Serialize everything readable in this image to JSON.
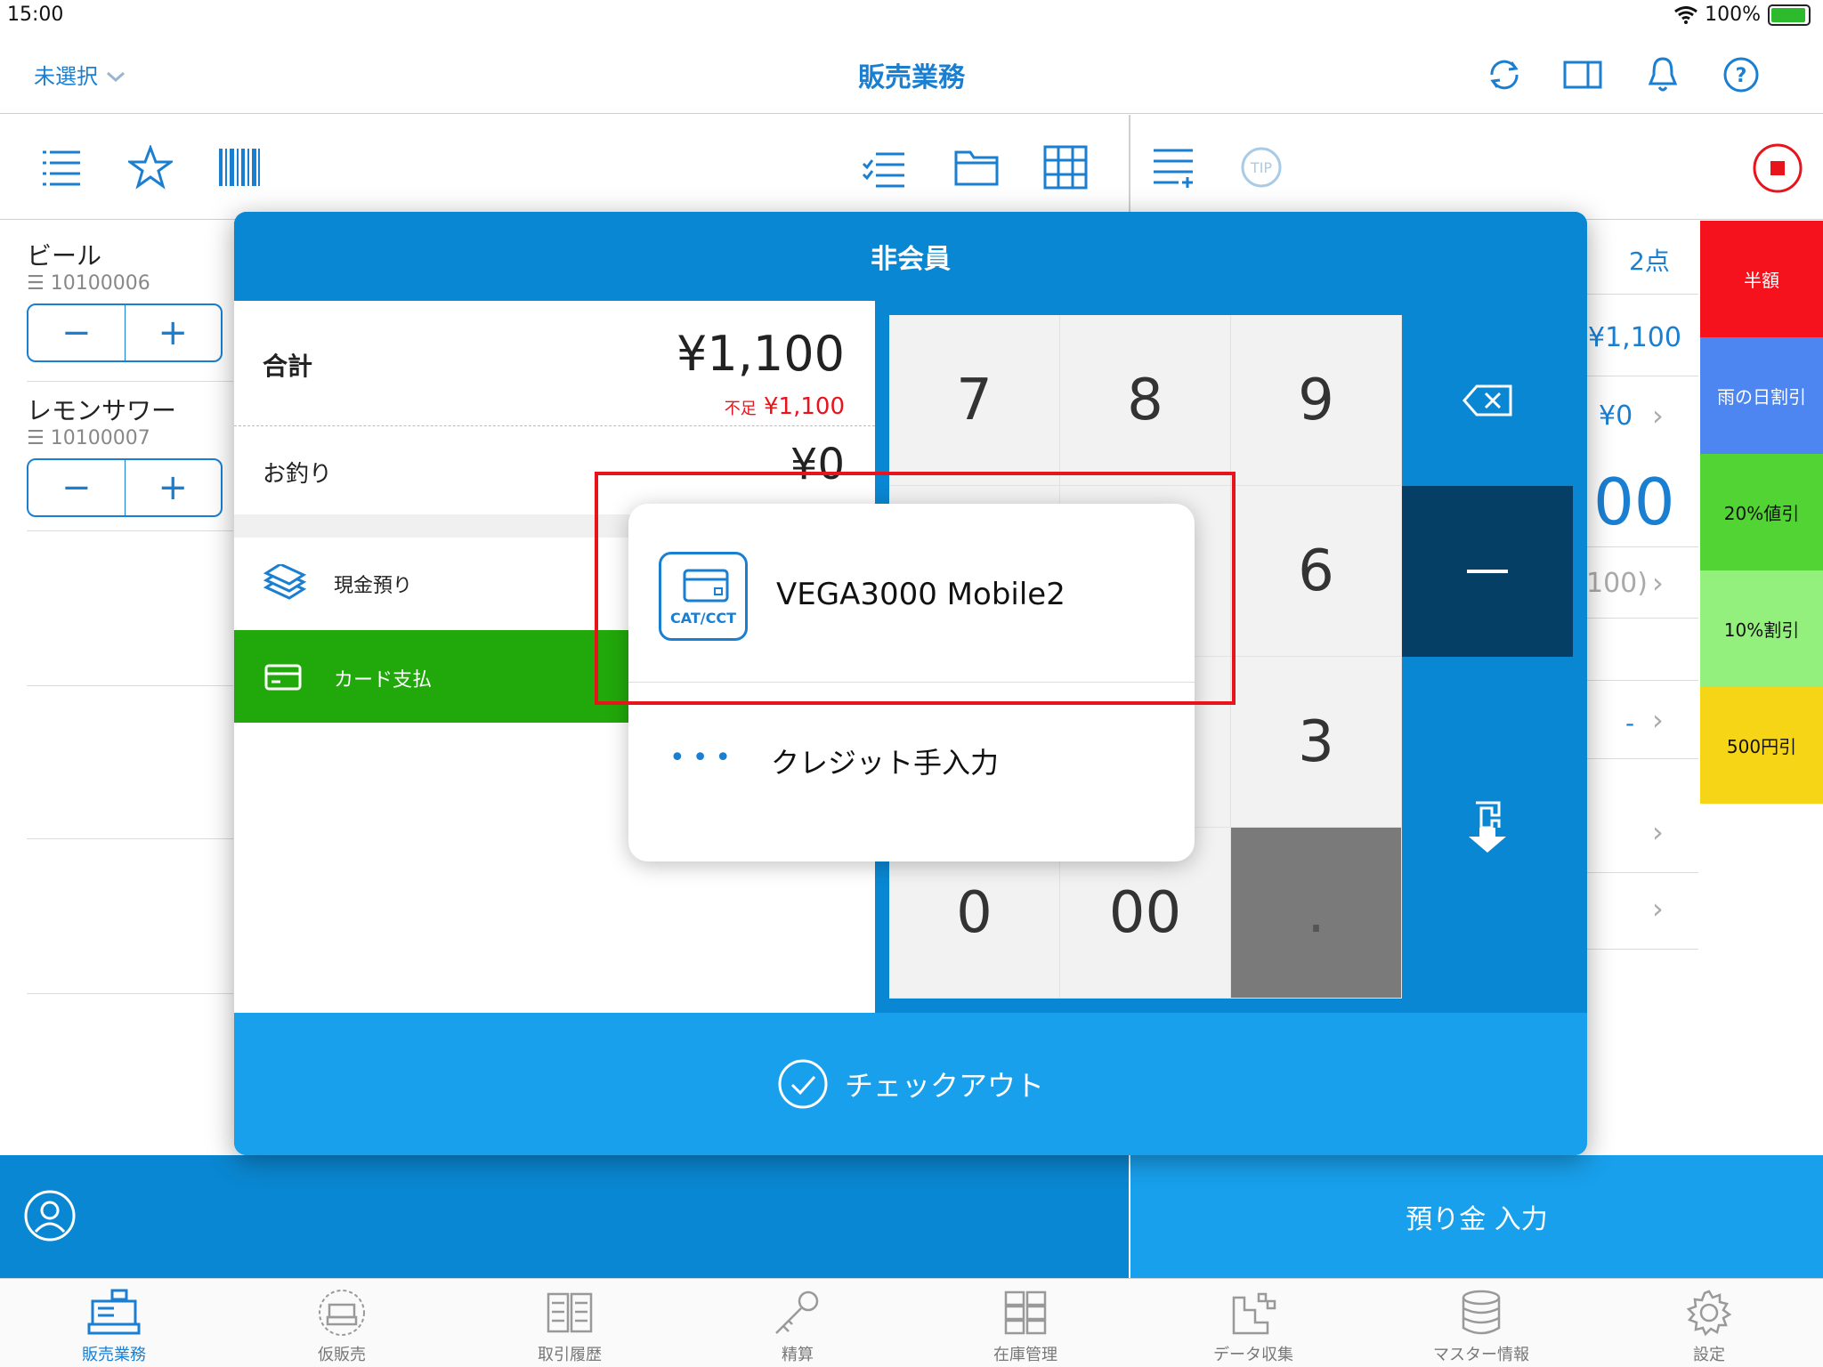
{
  "status": {
    "time": "15:00",
    "battery": "100%"
  },
  "nav": {
    "left_label": "未選択",
    "title": "販売業務"
  },
  "items": [
    {
      "name": "ビール",
      "code": "10100006"
    },
    {
      "name": "レモンサワー",
      "code": "10100007"
    }
  ],
  "stepper": {
    "minus": "−",
    "plus": "+"
  },
  "right_panel": {
    "count": "2点",
    "subtotal": "¥1,100",
    "discount": "¥0",
    "big_total": "00",
    "paren": "100)",
    "dash": "-"
  },
  "discounts": [
    {
      "label": "半額",
      "color": "#f5121c"
    },
    {
      "label": "雨の日割引",
      "color": "#4d86f0"
    },
    {
      "label": "20%値引",
      "color": "#52d434"
    },
    {
      "label": "10%割引",
      "color": "#93f07c"
    },
    {
      "label": "500円引",
      "color": "#f5d516"
    }
  ],
  "modal": {
    "title": "非会員",
    "total_label": "合計",
    "total_value": "¥1,100",
    "shortage_label": "不足",
    "shortage_value": "¥1,100",
    "change_label": "お釣り",
    "change_value": "¥0",
    "cash_label": "現金預り",
    "card_label": "カード支払",
    "checkout_label": "チェックアウト",
    "keys": [
      "7",
      "8",
      "9",
      "",
      "",
      "6",
      "",
      "",
      "3",
      "0",
      "00",
      "."
    ]
  },
  "popover": {
    "device_name": "VEGA3000 Mobile2",
    "device_badge": "CAT/CCT",
    "manual_label": "クレジット手入力"
  },
  "bottom": {
    "deposit_label": "預り金 入力"
  },
  "tabs": [
    {
      "label": "販売業務",
      "icon": "register-icon"
    },
    {
      "label": "仮販売",
      "icon": "temp-sale-icon"
    },
    {
      "label": "取引履歴",
      "icon": "history-icon"
    },
    {
      "label": "精算",
      "icon": "key-icon"
    },
    {
      "label": "在庫管理",
      "icon": "inventory-icon"
    },
    {
      "label": "データ収集",
      "icon": "data-icon"
    },
    {
      "label": "マスター情報",
      "icon": "database-icon"
    },
    {
      "label": "設定",
      "icon": "gear-icon"
    }
  ],
  "colors": {
    "accent": "#1a7fd1",
    "card_green": "#21a80a",
    "modal_blue": "#0a87d2",
    "highlight_red": "#e8141b"
  }
}
